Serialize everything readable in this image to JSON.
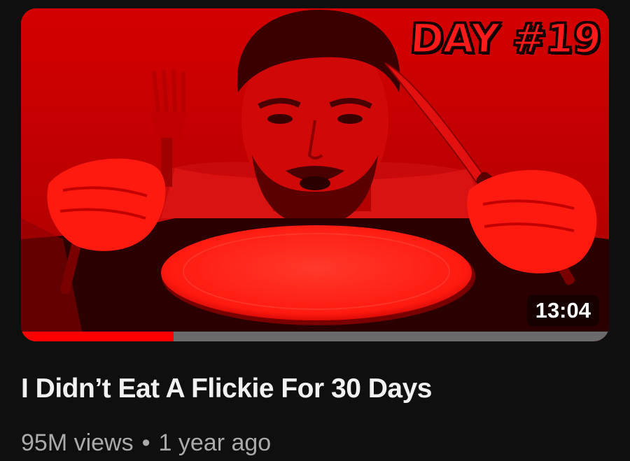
{
  "video": {
    "badge_text": "DAY #19",
    "duration": "13:04",
    "watch_progress": 0.26,
    "title": "I Didn’t Eat A Flickie For 30 Days",
    "views": "95M views",
    "separator": "•",
    "age": "1 year ago"
  },
  "colors": {
    "background": "#0f0f0f",
    "thumbnail_tint": "#ff0000",
    "progress_played": "#ff0000",
    "progress_remaining": "#6b6b6b",
    "title_text": "#f1f1f1",
    "meta_text": "#aaaaaa"
  },
  "icons": [
    "fork-icon",
    "knife-icon",
    "plate-icon"
  ]
}
